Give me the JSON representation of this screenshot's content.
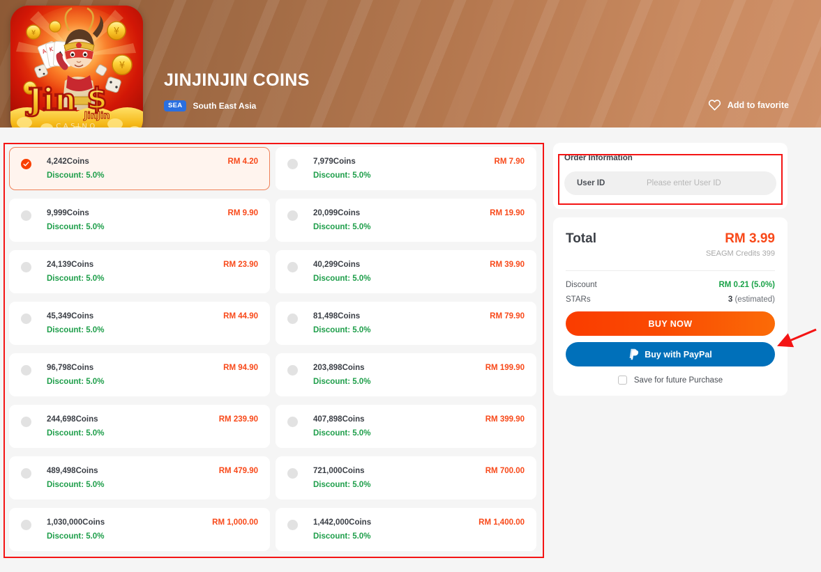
{
  "banner": {
    "title": "JINJINJIN COINS",
    "region_badge": "SEA",
    "region_name": "South East Asia",
    "favorite_label": "Add to favorite",
    "favorite_icon": "heart-icon",
    "thumbnail_alt": "JinJinJin Casino game artwork",
    "brand_color": "#b5784f"
  },
  "packages": {
    "left_column": [
      {
        "name": "4,242Coins",
        "price": "RM 4.20",
        "discount": "Discount: 5.0%",
        "selected": true
      },
      {
        "name": "9,999Coins",
        "price": "RM 9.90",
        "discount": "Discount: 5.0%",
        "selected": false
      },
      {
        "name": "24,139Coins",
        "price": "RM 23.90",
        "discount": "Discount: 5.0%",
        "selected": false
      },
      {
        "name": "45,349Coins",
        "price": "RM 44.90",
        "discount": "Discount: 5.0%",
        "selected": false
      },
      {
        "name": "96,798Coins",
        "price": "RM 94.90",
        "discount": "Discount: 5.0%",
        "selected": false
      },
      {
        "name": "244,698Coins",
        "price": "RM 239.90",
        "discount": "Discount: 5.0%",
        "selected": false
      },
      {
        "name": "489,498Coins",
        "price": "RM 479.90",
        "discount": "Discount: 5.0%",
        "selected": false
      },
      {
        "name": "1,030,000Coins",
        "price": "RM 1,000.00",
        "discount": "Discount: 5.0%",
        "selected": false
      }
    ],
    "right_column": [
      {
        "name": "7,979Coins",
        "price": "RM 7.90",
        "discount": "Discount: 5.0%",
        "selected": false
      },
      {
        "name": "20,099Coins",
        "price": "RM 19.90",
        "discount": "Discount: 5.0%",
        "selected": false
      },
      {
        "name": "40,299Coins",
        "price": "RM 39.90",
        "discount": "Discount: 5.0%",
        "selected": false
      },
      {
        "name": "81,498Coins",
        "price": "RM 79.90",
        "discount": "Discount: 5.0%",
        "selected": false
      },
      {
        "name": "203,898Coins",
        "price": "RM 199.90",
        "discount": "Discount: 5.0%",
        "selected": false
      },
      {
        "name": "407,898Coins",
        "price": "RM 399.90",
        "discount": "Discount: 5.0%",
        "selected": false
      },
      {
        "name": "721,000Coins",
        "price": "RM 700.00",
        "discount": "Discount: 5.0%",
        "selected": false
      },
      {
        "name": "1,442,000Coins",
        "price": "RM 1,400.00",
        "discount": "Discount: 5.0%",
        "selected": false
      }
    ]
  },
  "order": {
    "title": "Order Information",
    "user_id_label": "User ID",
    "user_id_value": "",
    "user_id_placeholder": "Please enter User ID"
  },
  "total": {
    "label": "Total",
    "price": "RM 3.99",
    "credits": "SEAGM Credits 399",
    "discount_label": "Discount",
    "discount_value": "RM 0.21 (5.0%)",
    "stars_label": "STARs",
    "stars_value": "3",
    "stars_note": "(estimated)"
  },
  "actions": {
    "buy_now": "BUY NOW",
    "paypal": "Buy with PayPal",
    "paypal_icon": "paypal-icon",
    "save_label": "Save for future Purchase",
    "save_checked": false
  },
  "colors": {
    "accent_orange": "#f8491a",
    "discount_green": "#1e9e4a",
    "paypal_blue": "#0070ba",
    "annotation_red": "#f41414",
    "page_bg": "#f5f5f5"
  }
}
